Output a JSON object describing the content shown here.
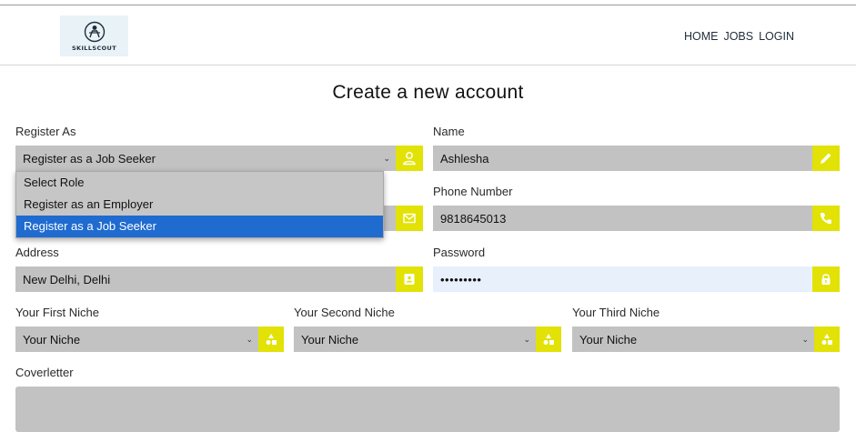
{
  "brand": {
    "name": "SKILLSCOUT"
  },
  "nav": {
    "home": "HOME",
    "jobs": "JOBS",
    "login": "LOGIN"
  },
  "page": {
    "title": "Create a new account"
  },
  "form": {
    "register_as": {
      "label": "Register As",
      "value": "Register as a Job Seeker",
      "icon": "user-icon"
    },
    "name": {
      "label": "Name",
      "value": "Ashlesha",
      "icon": "pencil-icon"
    },
    "email": {
      "icon": "mail-icon"
    },
    "phone": {
      "label": "Phone Number",
      "value": "9818645013",
      "icon": "phone-icon"
    },
    "address": {
      "label": "Address",
      "value": "New Delhi, Delhi",
      "icon": "contact-card-icon"
    },
    "password": {
      "label": "Password",
      "value": "•••••••••",
      "icon": "lock-icon"
    },
    "niche1": {
      "label": "Your First Niche",
      "value": "Your Niche",
      "icon": "shapes-icon"
    },
    "niche2": {
      "label": "Your Second Niche",
      "value": "Your Niche",
      "icon": "shapes-icon"
    },
    "niche3": {
      "label": "Your Third Niche",
      "value": "Your Niche",
      "icon": "shapes-icon"
    },
    "coverletter": {
      "label": "Coverletter"
    }
  },
  "dropdown": {
    "options": [
      "Select Role",
      "Register as an Employer",
      "Register as a Job Seeker"
    ],
    "selected_index": 2
  },
  "colors": {
    "accent": "#e2e207",
    "field_bg": "#c2c2c2",
    "highlight": "#1f6bd0",
    "autofill_bg": "#e7f0fb"
  }
}
